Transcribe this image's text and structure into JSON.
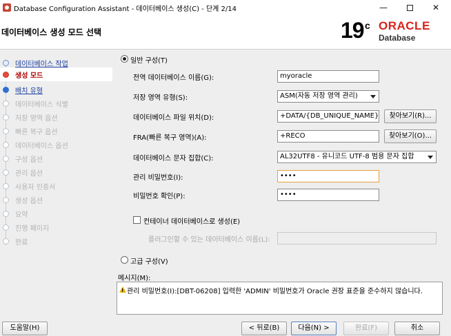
{
  "window": {
    "title": "Database Configuration Assistant - 데이터베이스 생성(C) - 단계 2/14"
  },
  "header": {
    "page_title": "데이터베이스 생성 모드 선택",
    "brand_version": "19",
    "brand_version_suffix": "c",
    "brand_name": "ORACLE",
    "brand_sub": "Database"
  },
  "sidebar": {
    "steps": [
      {
        "label": "데이터베이스 작업",
        "state": "done"
      },
      {
        "label": "생성 모드",
        "state": "active"
      },
      {
        "label": "배치 유형",
        "state": "link"
      },
      {
        "label": "데이터베이스 식별",
        "state": "pending"
      },
      {
        "label": "저장 영역 옵션",
        "state": "pending"
      },
      {
        "label": "빠른 복구 옵션",
        "state": "pending"
      },
      {
        "label": "데이터베이스 옵션",
        "state": "pending"
      },
      {
        "label": "구성 옵션",
        "state": "pending"
      },
      {
        "label": "관리 옵션",
        "state": "pending"
      },
      {
        "label": "사용자 인증서",
        "state": "pending"
      },
      {
        "label": "생성 옵션",
        "state": "pending"
      },
      {
        "label": "요약",
        "state": "pending"
      },
      {
        "label": "진행 페이지",
        "state": "pending"
      },
      {
        "label": "완료",
        "state": "pending"
      }
    ]
  },
  "form": {
    "typical_label": "일반 구성(T)",
    "typical_selected": true,
    "global_db_name_label": "전역 데이터베이스 이름(G):",
    "global_db_name_value": "myoracle",
    "storage_type_label": "저장 영역 유형(S):",
    "storage_type_value": "ASM(자동 저장 영역 관리)",
    "db_file_location_label": "데이터베이스 파일 위치(D):",
    "db_file_location_value": "+DATA/{DB_UNIQUE_NAME}",
    "browse_r_label": "찾아보기(R)...",
    "fra_label": "FRA(빠른 복구 영역)(A):",
    "fra_value": "+RECO",
    "browse_o_label": "찾아보기(O)...",
    "charset_label": "데이터베이스 문자 집합(C):",
    "charset_value": "AL32UTF8 - 유니코드 UTF-8 범용 문자 집합",
    "admin_password_label": "관리 비밀번호(I):",
    "admin_password_value": "••••",
    "confirm_password_label": "비밀번호 확인(P):",
    "confirm_password_value": "••••",
    "container_db_label": "컨테이너 데이터베이스로 생성(E)",
    "container_db_checked": false,
    "pluggable_db_label": "플러그인할 수 있는 데이터베이스 이름(L):",
    "pluggable_db_value": "",
    "advanced_label": "고급 구성(V)",
    "advanced_selected": false
  },
  "messages": {
    "label": "메시지(M):",
    "text": "관리 비밀번호(I):[DBT-06208] 입력한 'ADMIN' 비밀번호가 Oracle 권장 표준을 준수하지 않습니다."
  },
  "footer": {
    "help_label": "도움말(H)",
    "back_label": "< 뒤로(B)",
    "next_label": "다음(N) >",
    "finish_label": "완료(F)",
    "cancel_label": "취소"
  }
}
